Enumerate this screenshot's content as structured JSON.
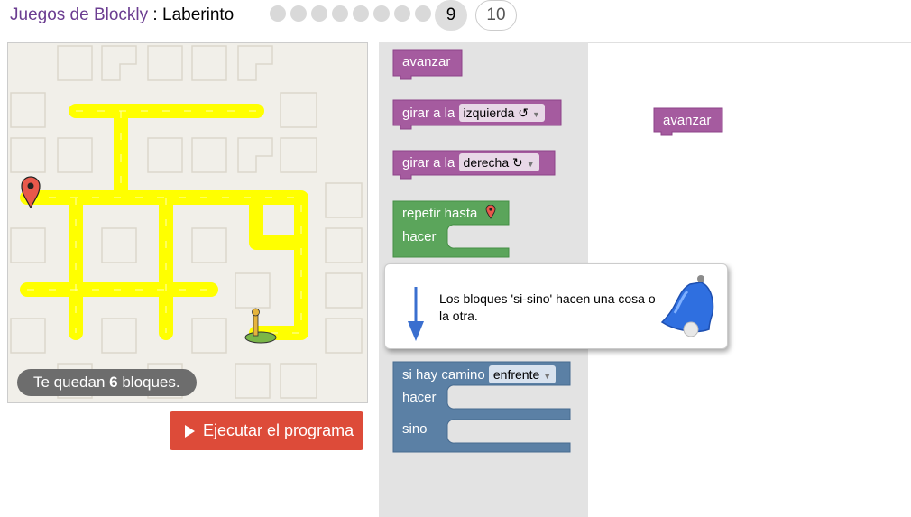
{
  "header": {
    "app_name": "Juegos de Blockly",
    "separator": " : ",
    "game_name": "Laberinto",
    "current_level": "9",
    "next_level": "10",
    "dot_count": 8
  },
  "maze": {
    "blocks_left_prefix": "Te quedan ",
    "blocks_left_count": "6",
    "blocks_left_suffix": " bloques."
  },
  "run_button": {
    "label": "Ejecutar el programa",
    "color": "#dd4b39"
  },
  "toolbox": {
    "move_forward": "avanzar",
    "turn_prefix": "girar a la",
    "turn_left_option": "izquierda ↺",
    "turn_right_option": "derecha ↻",
    "repeat_label": "repetir hasta",
    "do_label": "hacer",
    "if_label": "si hay camino",
    "if_option": "enfrente",
    "if_do_label": "hacer",
    "else_label": "sino"
  },
  "workspace": {
    "block_label": "avanzar"
  },
  "tooltip": {
    "text": "Los bloques 'si-sino' hacen una cosa o la otra."
  },
  "colors": {
    "accent_purple": "#a55b9f",
    "loop_green": "#5ba55b",
    "logic_blue": "#5b80a5",
    "path_yellow": "#ffff00"
  }
}
